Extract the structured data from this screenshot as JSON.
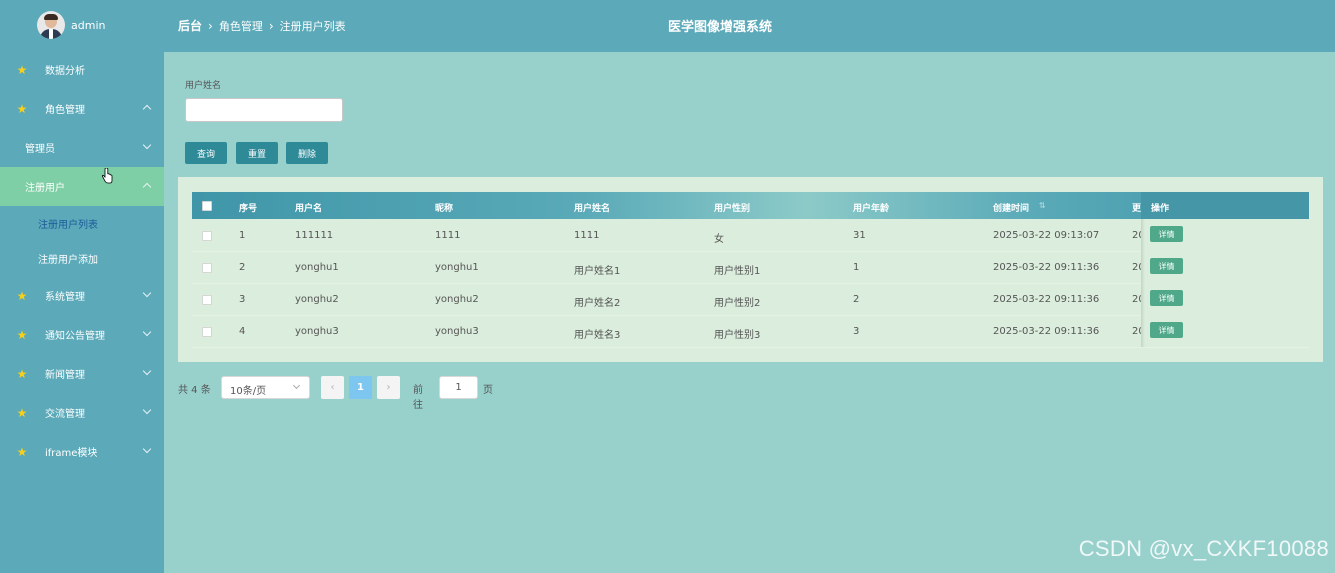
{
  "user": {
    "name": "admin"
  },
  "header": {
    "breadcrumb": [
      "后台",
      "角色管理",
      "注册用户列表"
    ],
    "system_title": "医学图像增强系统"
  },
  "sidebar": {
    "items": [
      {
        "label": "数据分析",
        "icon": "star-icon"
      },
      {
        "label": "角色管理",
        "icon": "star-icon",
        "expanded": true
      },
      {
        "label": "管理员"
      },
      {
        "label": "注册用户",
        "expanded": true
      },
      {
        "label": "注册用户列表"
      },
      {
        "label": "注册用户添加"
      },
      {
        "label": "系统管理",
        "icon": "star-icon"
      },
      {
        "label": "通知公告管理",
        "icon": "star-icon"
      },
      {
        "label": "新闻管理",
        "icon": "star-icon"
      },
      {
        "label": "交流管理",
        "icon": "star-icon"
      },
      {
        "label": "iframe模块",
        "icon": "star-icon"
      }
    ]
  },
  "search": {
    "field_label": "用户姓名",
    "value": "",
    "buttons": {
      "query": "查询",
      "reset": "重置",
      "delete": "删除"
    }
  },
  "table": {
    "columns": [
      "序号",
      "用户名",
      "昵称",
      "用户姓名",
      "用户性别",
      "用户年龄",
      "创建时间",
      "更",
      "操作"
    ],
    "detail_label": "详情",
    "rows": [
      {
        "index": "1",
        "username": "111111",
        "nickname": "1111",
        "realname": "1111",
        "gender": "女",
        "age": "31",
        "created": "2025-03-22 09:13:07",
        "cut": "20"
      },
      {
        "index": "2",
        "username": "yonghu1",
        "nickname": "yonghu1",
        "realname": "用户姓名1",
        "gender": "用户性别1",
        "age": "1",
        "created": "2025-03-22 09:11:36",
        "cut": "20"
      },
      {
        "index": "3",
        "username": "yonghu2",
        "nickname": "yonghu2",
        "realname": "用户姓名2",
        "gender": "用户性别2",
        "age": "2",
        "created": "2025-03-22 09:11:36",
        "cut": "20"
      },
      {
        "index": "4",
        "username": "yonghu3",
        "nickname": "yonghu3",
        "realname": "用户姓名3",
        "gender": "用户性别3",
        "age": "3",
        "created": "2025-03-22 09:11:36",
        "cut": "20"
      }
    ]
  },
  "pagination": {
    "total": "共 4 条",
    "page_size": "10条/页",
    "prev": "‹",
    "current": "1",
    "next": "›",
    "goto_label": "前往",
    "goto_value": "1",
    "page_suffix": "页"
  },
  "watermark": "CSDN @vx_CXKF10088",
  "colors": {
    "sidebar": "#5ba9b9",
    "content": "#98d0cc",
    "active_menu": "#7ecfa5",
    "button": "#2f8a98",
    "detail_button": "#4fa88a",
    "star": "#f6d01c",
    "current_page": "#7cc6ef"
  }
}
